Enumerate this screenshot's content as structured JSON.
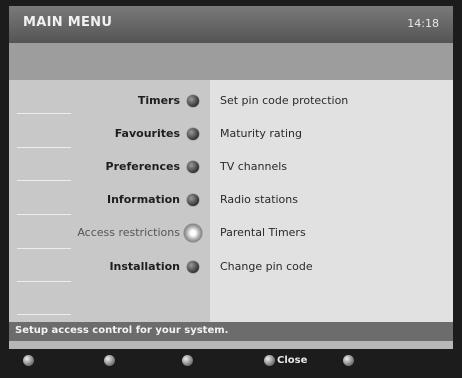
{
  "header": {
    "title": "MAIN MENU",
    "time": "14:18"
  },
  "menu": [
    {
      "label": "Timers"
    },
    {
      "label": "Favourites"
    },
    {
      "label": "Preferences"
    },
    {
      "label": "Information"
    },
    {
      "label": "Access restrictions"
    },
    {
      "label": "Installation"
    }
  ],
  "submenu": [
    {
      "label": "Set pin code protection"
    },
    {
      "label": "Maturity rating"
    },
    {
      "label": "TV channels"
    },
    {
      "label": "Radio stations"
    },
    {
      "label": "Parental Timers"
    },
    {
      "label": "Change pin code"
    }
  ],
  "status": "Setup access control for your system.",
  "footer": {
    "close_label": "Close"
  },
  "colors": {
    "header": "#5f5f5f",
    "left_panel": "#c8c8c8",
    "right_panel": "#e1e1e1",
    "status_bar": "#6c6c6c"
  }
}
